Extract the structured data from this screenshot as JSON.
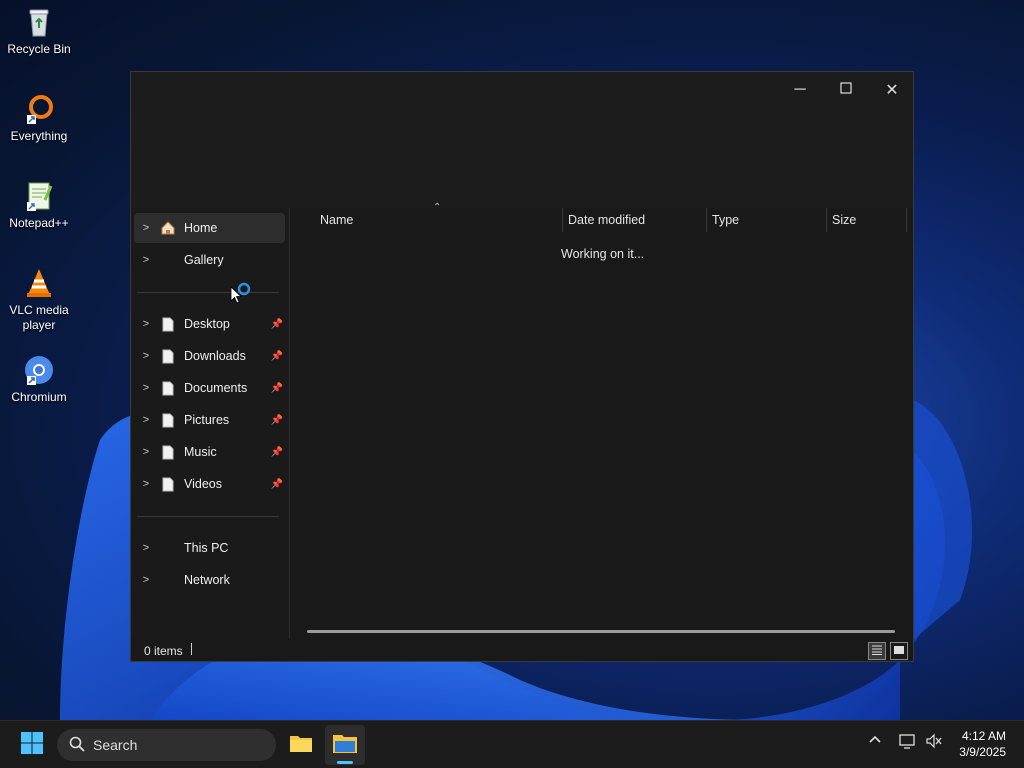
{
  "desktop": {
    "icons": [
      {
        "label": "Recycle Bin",
        "icon": "recycle-bin-icon"
      },
      {
        "label": "Everything",
        "icon": "everything-icon"
      },
      {
        "label": "Notepad++",
        "icon": "notepad-plus-plus-icon"
      },
      {
        "label": "VLC media player",
        "icon": "vlc-icon"
      },
      {
        "label": "Chromium",
        "icon": "chromium-icon"
      }
    ]
  },
  "window": {
    "controls": {
      "minimize": "─",
      "maximize": "☐",
      "close": "✕"
    },
    "nav": {
      "top": [
        {
          "label": "Home",
          "icon": "home-icon",
          "selected": true
        },
        {
          "label": "Gallery",
          "icon": "gallery-icon"
        }
      ],
      "pinned": [
        {
          "label": "Desktop",
          "icon": "folder-icon"
        },
        {
          "label": "Downloads",
          "icon": "folder-icon"
        },
        {
          "label": "Documents",
          "icon": "folder-icon"
        },
        {
          "label": "Pictures",
          "icon": "folder-icon"
        },
        {
          "label": "Music",
          "icon": "folder-icon"
        },
        {
          "label": "Videos",
          "icon": "folder-icon"
        }
      ],
      "bottom": [
        {
          "label": "This PC"
        },
        {
          "label": "Network"
        }
      ]
    },
    "columns": [
      "Name",
      "Date modified",
      "Type",
      "Size"
    ],
    "status_message": "Working on it...",
    "status_bar": {
      "items": "0 items"
    }
  },
  "taskbar": {
    "search_placeholder": "Search",
    "clock": {
      "time": "4:12 AM",
      "date": "3/9/2025"
    }
  },
  "colors": {
    "accent": "#0078d4",
    "window_bg": "#191919",
    "taskbar_bg": "#1c1c1c"
  }
}
